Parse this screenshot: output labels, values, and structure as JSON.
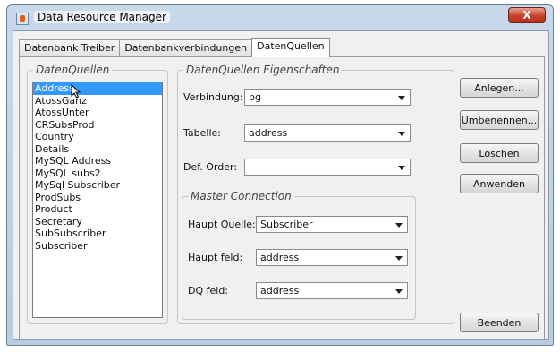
{
  "window": {
    "title": "Data Resource Manager",
    "close_label": "X"
  },
  "tabs": [
    {
      "label": "Datenbank Treiber"
    },
    {
      "label": "Datenbankverbindungen"
    },
    {
      "label": "DatenQuellen"
    }
  ],
  "datasources": {
    "legend": "DatenQuellen",
    "items": [
      {
        "label": "Address"
      },
      {
        "label": "AtossGanz"
      },
      {
        "label": "AtossUnter"
      },
      {
        "label": "CRSubsProd"
      },
      {
        "label": "Country"
      },
      {
        "label": "Details"
      },
      {
        "label": "MySQL Address"
      },
      {
        "label": "MySQL subs2"
      },
      {
        "label": "MySql Subscriber"
      },
      {
        "label": "ProdSubs"
      },
      {
        "label": "Product"
      },
      {
        "label": "Secretary"
      },
      {
        "label": "SubSubscriber"
      },
      {
        "label": "Subscriber"
      }
    ],
    "selected": "Address"
  },
  "properties": {
    "legend": "DatenQuellen Eigenschaften",
    "verbindung": {
      "label": "Verbindung:",
      "value": "pg"
    },
    "tabelle": {
      "label": "Tabelle:",
      "value": "address"
    },
    "def_order": {
      "label": "Def. Order:",
      "value": ""
    },
    "master": {
      "legend": "Master Connection",
      "haupt_quelle": {
        "label": "Haupt Quelle:",
        "value": "Subscriber"
      },
      "haupt_feld": {
        "label": "Haupt feld:",
        "value": "address"
      },
      "dq_feld": {
        "label": "DQ feld:",
        "value": "address"
      }
    }
  },
  "buttons": {
    "anlegen": "Anlegen...",
    "umbenennen": "Umbenennen...",
    "loeschen": "Löschen",
    "anwenden": "Anwenden",
    "beenden": "Beenden"
  },
  "icons": {
    "app": "java-cup-icon",
    "cursor": "mouse-pointer-icon"
  },
  "colors": {
    "selection": "#3399ff",
    "close_button": "#c6412a"
  }
}
